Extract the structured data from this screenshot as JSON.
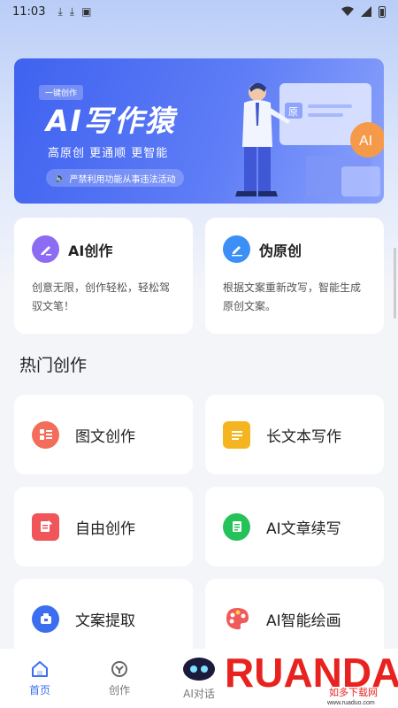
{
  "status_bar": {
    "time": "11:03"
  },
  "banner": {
    "tag": "一键创作",
    "title": "AI写作猿",
    "subtitle": "高原创 更通顺 更智能",
    "notice": "严禁利用功能从事违法活动",
    "badge_text": "AI",
    "doc_label": "原"
  },
  "top_cards": [
    {
      "title": "AI创作",
      "desc": "创意无限，创作轻松，轻松驾驭文笔！",
      "color": "#8b6cf2"
    },
    {
      "title": "伪原创",
      "desc": "根据文案重新改写，智能生成原创文案。",
      "color": "#3b8ff5"
    }
  ],
  "section_title": "热门创作",
  "features": [
    {
      "label": "图文创作",
      "icon": "image-text-icon",
      "color": "#f36d5a"
    },
    {
      "label": "长文本写作",
      "icon": "long-text-icon",
      "color": "#f5b521"
    },
    {
      "label": "自由创作",
      "icon": "free-write-icon",
      "color": "#f0555a"
    },
    {
      "label": "AI文章续写",
      "icon": "continue-write-icon",
      "color": "#25c25a"
    },
    {
      "label": "文案提取",
      "icon": "extract-icon",
      "color": "#3b6ff0"
    },
    {
      "label": "AI智能绘画",
      "icon": "palette-icon",
      "color": "#f05a5a"
    }
  ],
  "nav": {
    "home": "首页",
    "create": "创作",
    "ai_chat": "AI对话"
  },
  "watermark": {
    "brand": "RUANDADO",
    "cn": "如多下载网",
    "url": "www.ruaduo.com"
  },
  "colors": {
    "accent": "#3a6ff0",
    "banner": "#4a6cf2"
  }
}
